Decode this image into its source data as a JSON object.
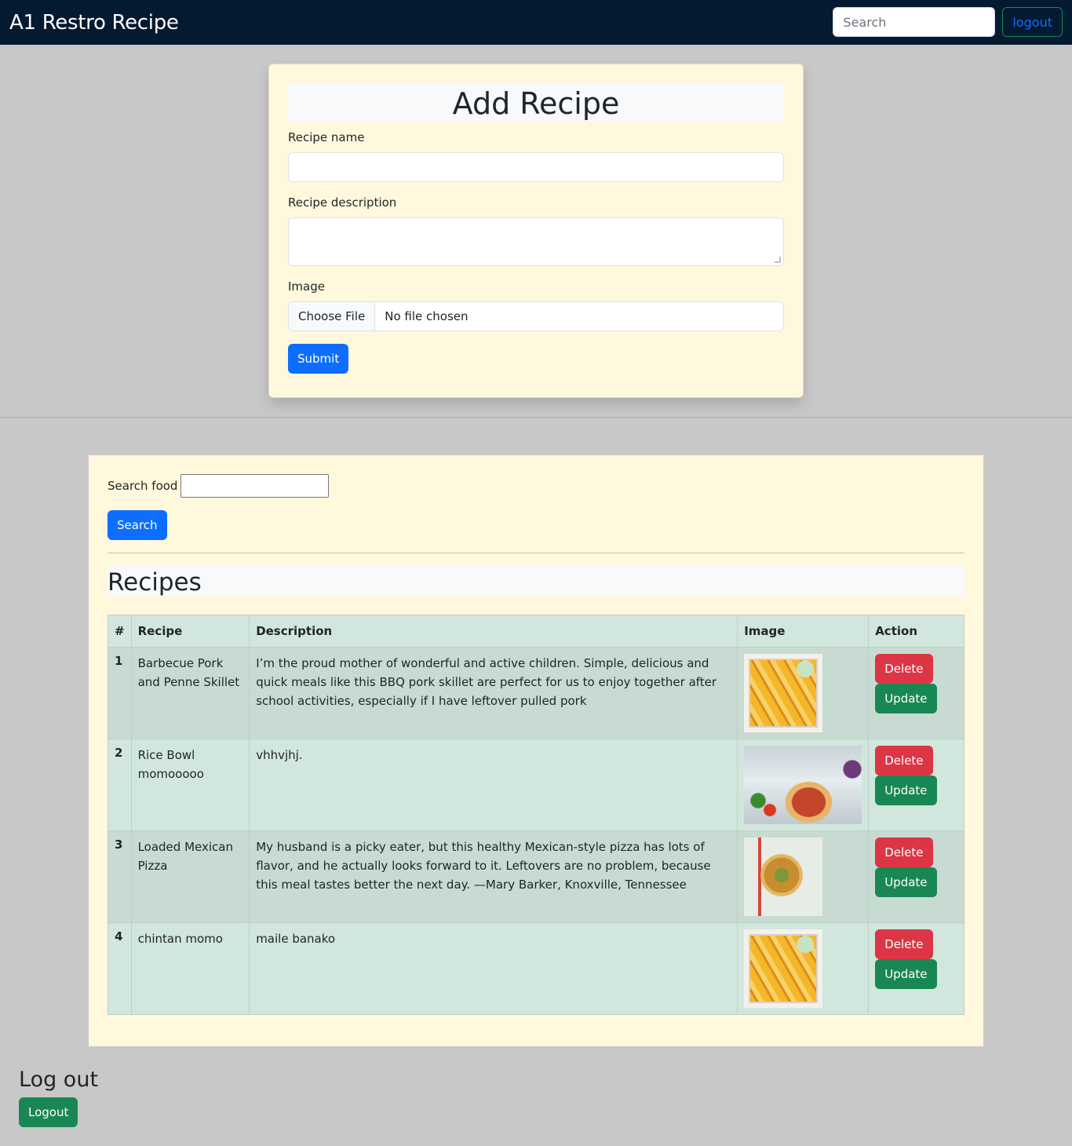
{
  "navbar": {
    "brand": "A1 Restro Recipe",
    "search_placeholder": "Search",
    "logout_label": "logout"
  },
  "add_form": {
    "title": "Add Recipe",
    "name_label": "Recipe name",
    "name_value": "",
    "description_label": "Recipe description",
    "description_value": "",
    "image_label": "Image",
    "file_button": "Choose File",
    "file_status": "No file chosen",
    "submit_label": "Submit"
  },
  "recipe_list": {
    "search_label": "Search food",
    "search_value": "",
    "search_button": "Search",
    "title": "Recipes",
    "columns": [
      "#",
      "Recipe",
      "Description",
      "Image",
      "Action"
    ],
    "rows": [
      {
        "num": "1",
        "recipe": "Barbecue Pork and Penne Skillet",
        "description": "I’m the proud mother of wonderful and active children. Simple, delicious and quick meals like this BBQ pork skillet are perfect for us to enjoy together after school activities, especially if I have leftover pulled pork",
        "image": "lasagna-dish",
        "delete": "Delete",
        "update": "Update"
      },
      {
        "num": "2",
        "recipe": "Rice Bowl momooooo",
        "description": "vhhvjhj.",
        "image": "pizza-kitchen",
        "delete": "Delete",
        "update": "Update"
      },
      {
        "num": "3",
        "recipe": "Loaded Mexican Pizza",
        "description": "My husband is a picky eater, but this healthy Mexican-style pizza has lots of flavor, and he actually looks forward to it. Leftovers are no problem, because this meal tastes better the next day. —Mary Barker, Knoxville, Tennessee",
        "image": "mexican-pizza",
        "delete": "Delete",
        "update": "Update"
      },
      {
        "num": "4",
        "recipe": "chintan momo",
        "description": "maile banako",
        "image": "lasagna-dish",
        "delete": "Delete",
        "update": "Update"
      }
    ]
  },
  "footer": {
    "title": "Log out",
    "button": "Logout"
  }
}
